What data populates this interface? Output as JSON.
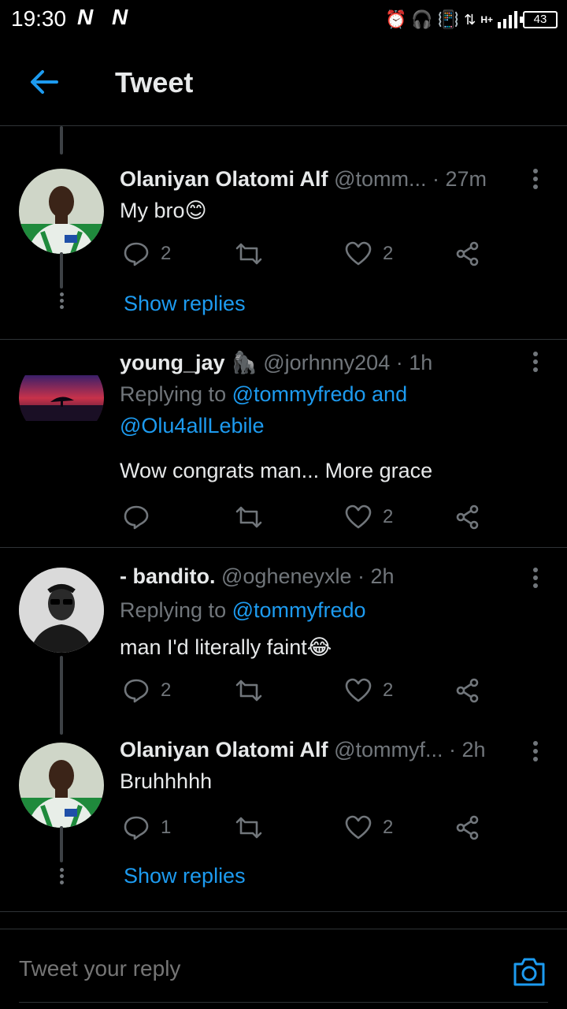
{
  "status_bar": {
    "time": "19:30",
    "notification_icons": [
      "N",
      "N"
    ],
    "battery": "43",
    "network": "H+"
  },
  "header": {
    "title": "Tweet"
  },
  "tweets": [
    {
      "name": "Olaniyan Olatomi Alf",
      "handle": "@tomm...",
      "time": "· 27m",
      "text": "My bro😊",
      "replies": "2",
      "likes": "2",
      "show_replies": "Show replies"
    },
    {
      "name": "young_jay",
      "badge": "🦍",
      "handle": "@jorhnny204",
      "time": "· 1h",
      "replying_prefix": "Replying to ",
      "mention1": "@tommyfredo and",
      "mention2": "@Olu4allLebile",
      "text": "Wow congrats man... More grace",
      "likes": "2"
    },
    {
      "name": "- bandito.",
      "handle": "@ogheneyxle",
      "time": "· 2h",
      "replying_prefix": "Replying to ",
      "mention1": "@tommyfredo",
      "text": "man I'd literally faint😂",
      "replies": "2",
      "likes": "2"
    },
    {
      "name": "Olaniyan Olatomi Alf",
      "handle": "@tommyf...",
      "time": "· 2h",
      "text": "Bruhhhhh",
      "replies": "1",
      "likes": "2",
      "show_replies": "Show replies"
    }
  ],
  "reply_bar": {
    "placeholder": "Tweet your reply"
  },
  "colors": {
    "accent": "#1d9bf0",
    "muted": "#71767b",
    "background": "#000000"
  }
}
